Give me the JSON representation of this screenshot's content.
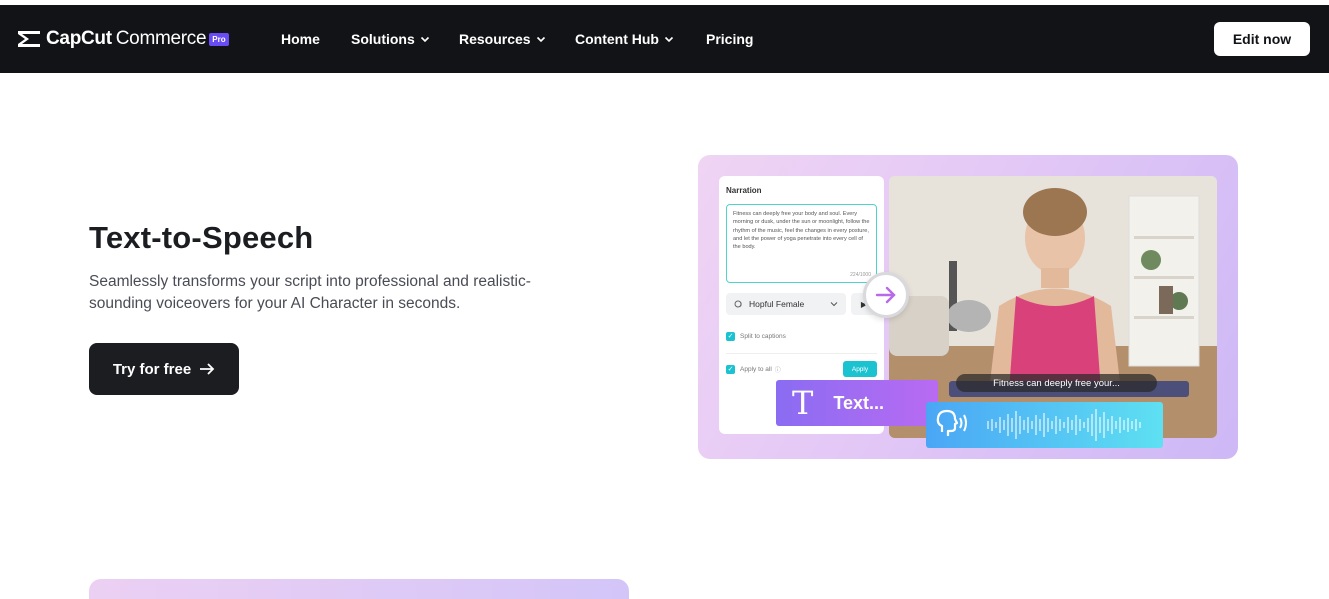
{
  "nav": {
    "brand": "CapCut",
    "brand_product": "Commerce",
    "badge": "Pro",
    "items": [
      {
        "label": "Home",
        "has_dropdown": false
      },
      {
        "label": "Solutions",
        "has_dropdown": true
      },
      {
        "label": "Resources",
        "has_dropdown": true
      },
      {
        "label": "Content Hub",
        "has_dropdown": true
      },
      {
        "label": "Pricing",
        "has_dropdown": false
      }
    ],
    "cta": "Edit now"
  },
  "hero": {
    "title": "Text-to-Speech",
    "description": "Seamlessly transforms your script into professional and realistic-sounding voiceovers for your AI Character in seconds.",
    "cta": "Try for free"
  },
  "illustration": {
    "panel_title": "Narration",
    "narration_text": "Fitness can deeply free your body and soul. Every morning or dusk, under the sun or moonlight, follow the rhythm of the music, feel the changes in every posture, and let the power of yoga penetrate into every cell of the body.",
    "char_count": "224/1000",
    "voice": "Hopful Female",
    "split_captions": "Split to captions",
    "apply_all": "Apply to all",
    "apply_button": "Apply",
    "caption": "Fitness can deeply free your...",
    "text_chip": "Text..."
  },
  "colors": {
    "nav_bg": "#121316",
    "badge": "#6a4cf5",
    "cta_dark": "#1c1d21",
    "accent_teal": "#1bc2d0"
  }
}
